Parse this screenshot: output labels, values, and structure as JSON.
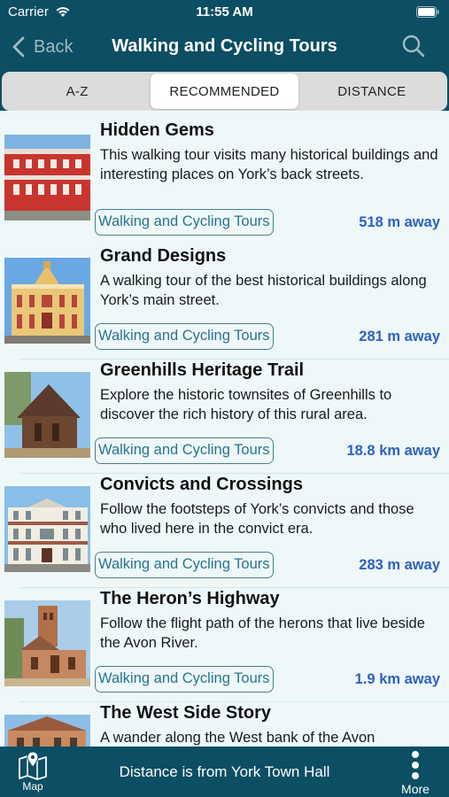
{
  "status_bar": {
    "carrier": "Carrier",
    "time": "11:55 AM"
  },
  "nav": {
    "back_label": "Back",
    "title": "Walking and Cycling Tours"
  },
  "segments": [
    "A-Z",
    "RECOMMENDED",
    "DISTANCE"
  ],
  "active_segment": "RECOMMENDED",
  "tours": [
    {
      "title": "Hidden Gems",
      "description": "This walking tour visits many historical buildings and interesting places on York’s back streets.",
      "tag": "Walking and Cycling Tours",
      "distance": "518 m away"
    },
    {
      "title": "Grand Designs",
      "description": "A walking tour of the best historical buildings along York’s main street.",
      "tag": "Walking and Cycling Tours",
      "distance": "281 m away"
    },
    {
      "title": "Greenhills Heritage Trail",
      "description": "Explore the historic townsites of Greenhills to discover the rich history of this rural area.",
      "tag": "Walking and Cycling Tours",
      "distance": "18.8 km away"
    },
    {
      "title": "Convicts and Crossings",
      "description": "Follow the footsteps of York’s convicts and those who lived here in the convict era.",
      "tag": "Walking and Cycling Tours",
      "distance": "283 m away"
    },
    {
      "title": "The Heron’s Highway",
      "description": "Follow the flight path of the herons that live beside the Avon River.",
      "tag": "Walking and Cycling Tours",
      "distance": "1.9 km away"
    },
    {
      "title": "The West Side Story",
      "description": "A wander along the West bank of the Avon",
      "tag": "",
      "distance": ""
    }
  ],
  "bottom_bar": {
    "map_label": "Map",
    "info_text": "Distance is from York Town Hall",
    "more_label": "More"
  },
  "colors": {
    "header_bg": "#0c4e63",
    "list_bg": "#eef8f9",
    "tag_text": "#29738a",
    "distance_text": "#2f5fbf"
  },
  "icons": [
    "wifi-icon",
    "battery-icon",
    "chevron-left-icon",
    "search-icon",
    "map-icon",
    "more-dots-icon"
  ]
}
